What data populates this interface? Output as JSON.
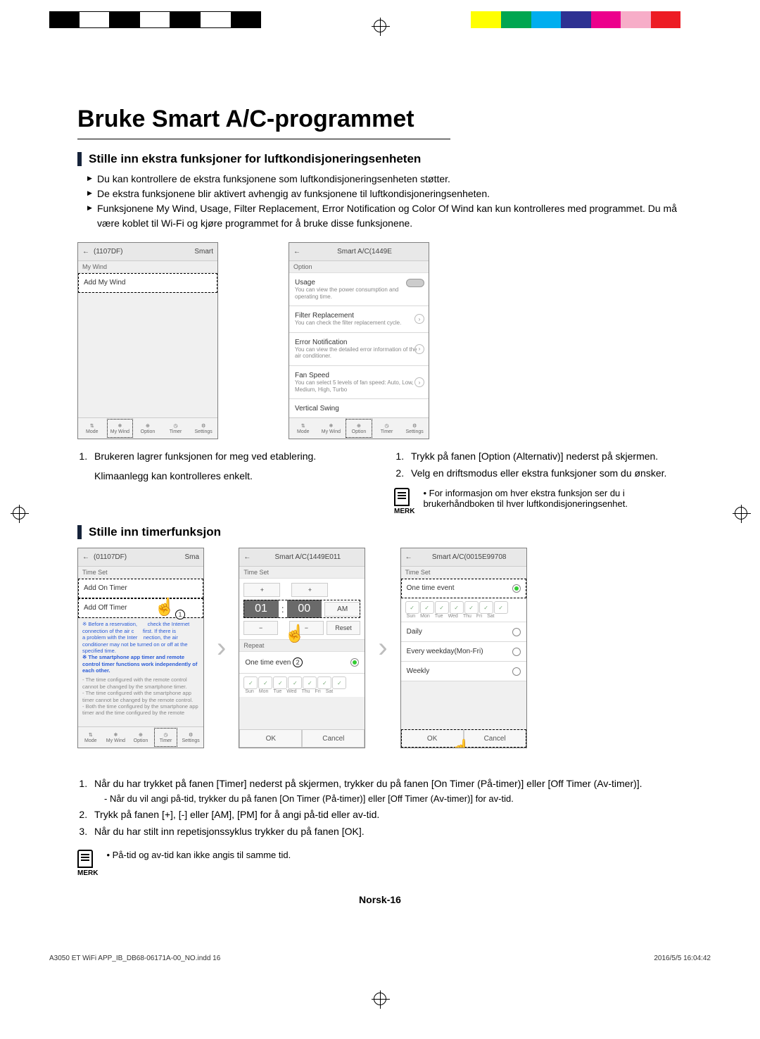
{
  "colorbar": [
    "#000",
    "#fff",
    "#000",
    "#fff",
    "#000",
    "#fff",
    "#000",
    "#fff",
    "#fff",
    "#fff",
    "#fff",
    "#fff",
    "#fff",
    "#fff",
    "#ffff00",
    "#00a651",
    "#00aeef",
    "#2e3192",
    "#ec008c",
    "#f7adc8",
    "#ed1c24",
    "#fff"
  ],
  "title": "Bruke Smart A/C-programmet",
  "section1": {
    "heading": "Stille inn ekstra funksjoner for luftkondisjoneringsenheten",
    "bullets": [
      "Du kan kontrollere de ekstra funksjonene som luftkondisjoneringsenheten støtter.",
      "De ekstra funksjonene blir aktivert avhengig av funksjonene til luftkondisjoneringsenheten.",
      "Funksjonene My Wind, Usage, Filter Replacement, Error Notification og Color Of Wind kan kun kontrolleres med programmet. Du må være koblet til Wi-Fi og kjøre programmet for å bruke disse funksjonene."
    ]
  },
  "shot1": {
    "header_dev": "(1107DF)",
    "header_mode": "Smart",
    "tab": "My Wind",
    "item": "Add My Wind",
    "bottom": [
      "Mode",
      "My Wind",
      "Option",
      "Timer",
      "Settings"
    ]
  },
  "shot2": {
    "header": "Smart A/C(1449E",
    "section": "Option",
    "items": [
      {
        "t": "Usage",
        "s": "You can view the power consumption and operating time."
      },
      {
        "t": "Filter Replacement",
        "s": "You can check the filter replacement cycle."
      },
      {
        "t": "Error Notification",
        "s": "You can view the detailed error information of the air conditioner."
      },
      {
        "t": "Fan Speed",
        "s": "You can select 5 levels of fan speed: Auto, Low, Medium, High, Turbo"
      },
      {
        "t": "Vertical Swing",
        "s": ""
      }
    ],
    "bottom": [
      "Mode",
      "My Wind",
      "Option",
      "Timer",
      "Settings"
    ]
  },
  "left_steps": {
    "s1": "Brukeren lagrer funksjonen for meg ved etablering.",
    "s1b": "Klimaanlegg kan kontrolleres enkelt."
  },
  "right_steps": {
    "s1": "Trykk på fanen [Option (Alternativ)] nederst på skjermen.",
    "s2": "Velg en driftsmodus eller ekstra funksjoner som du ønsker."
  },
  "merk_label": "MERK",
  "merk1": "For informasjon om hver ekstra funksjon ser du i brukerhåndboken til hver luftkondisjoneringsenhet.",
  "section2": {
    "heading": "Stille inn timerfunksjon"
  },
  "timer1": {
    "header_dev": "(01107DF)",
    "header_mode": "Sma",
    "section": "Time Set",
    "add_on": "Add On Timer",
    "add_off": "Add Off Timer",
    "blue1": "※ Before a reservation,",
    "blue1b": "check the Internet",
    "blue2": "connection of the air c",
    "blue2b": "first. If there is",
    "blue3": "a problem with the Inter",
    "blue3b": "nection, the air",
    "blue4": "conditioner may not be turned on or off at the specified time.",
    "blue5": "※ The smartphone app timer and remote control timer functions work independently of each other.",
    "grey1": "- The time configured with the remote control cannot be changed by the smartphone timer.",
    "grey2": "- The time configured with the smartphone app timer cannot be changed by the remote control.",
    "grey3": "- Both the time configured by the smartphone app timer and the time configured by the remote",
    "bottom": [
      "Mode",
      "My Wind",
      "Option",
      "Timer",
      "Settings"
    ]
  },
  "timer2": {
    "header": "Smart A/C(1449E011",
    "section": "Time Set",
    "hh": "01",
    "mm": "00",
    "ampm": "AM",
    "reset": "Reset",
    "repeat": "Repeat",
    "ote": "One time even",
    "days": [
      "Sun",
      "Mon",
      "Tue",
      "Wed",
      "Thu",
      "Fri",
      "Sat"
    ],
    "ok": "OK",
    "cancel": "Cancel",
    "plus": "+",
    "minus": "−"
  },
  "timer3": {
    "header": "Smart A/C(0015E99708",
    "section": "Time Set",
    "items": [
      "One time event",
      "Daily",
      "Every weekday(Mon-Fri)",
      "Weekly"
    ],
    "days": [
      "Sun",
      "Mon",
      "Tue",
      "Wed",
      "Thu",
      "Fri",
      "Sat"
    ],
    "ok": "OK",
    "cancel": "Cancel"
  },
  "bottom_steps": {
    "s1": "Når du har trykket på fanen [Timer] nederst på skjermen, trykker du på fanen [On Timer (På-timer)] eller [Off Timer (Av-timer)].",
    "s1a": "-  Når du vil angi på-tid, trykker du på fanen [On Timer (På-timer)] eller [Off Timer (Av-timer)] for av-tid.",
    "s2": "Trykk på fanen [+], [-] eller [AM], [PM] for å angi på-tid eller av-tid.",
    "s3": "Når du har stilt inn repetisjonssyklus trykker du på fanen [OK]."
  },
  "merk2": "På-tid og av-tid kan ikke angis til samme tid.",
  "pagenum": "Norsk-16",
  "footer": {
    "left": "A3050 ET WiFi APP_IB_DB68-06171A-00_NO.indd   16",
    "right": "2016/5/5   16:04:42"
  },
  "nums": {
    "n1": "1",
    "n2": "2",
    "n3": "3"
  }
}
